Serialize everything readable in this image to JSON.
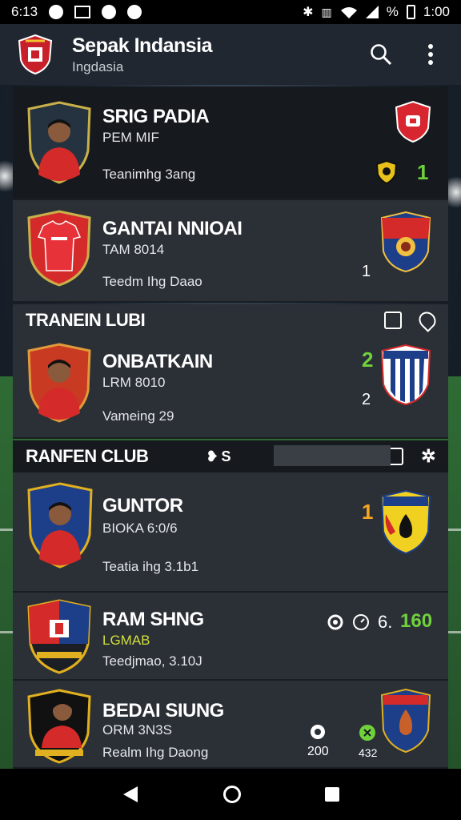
{
  "status_bar": {
    "time": "6:13",
    "right_text": "1:00",
    "battery_glyph": "%"
  },
  "app_bar": {
    "title": "Sepak Indansia",
    "subtitle": "Ingdasia",
    "search_icon": "search-icon",
    "menu_icon": "more-vert-icon"
  },
  "colors": {
    "accent_green": "#6fd23b",
    "accent_orange": "#f5a623",
    "card_bg": "#2b2f36",
    "dark_card_bg": "#16191e"
  },
  "cards": [
    {
      "name": "SRIG PADIA",
      "sub": "PEM MIF",
      "meta": "Teanimhg 3ang",
      "score_top": "",
      "score_bottom": "1"
    },
    {
      "name": "GANTAI NNIOAI",
      "sub": "TAM 8014",
      "meta": "Teedm Ihg Daao",
      "score_top": "",
      "score_bottom": "1"
    },
    {
      "name": "ONBATKAIN",
      "sub": "LRM 8010",
      "meta": "Vameing 29",
      "score_top": "2",
      "score_bottom": "2"
    },
    {
      "name": "GUNTOR",
      "sub": "BIOKA 6:0/6",
      "meta": "Teatia ihg 3.1b1",
      "score_top": "1",
      "score_bottom": ""
    },
    {
      "name": "RAM SHNG",
      "sub": "LGMAB",
      "meta": "Teedjmao, 3.10J",
      "score_top": "160",
      "score_prefix": "6.",
      "score_bottom": ""
    },
    {
      "name": "BEDAI SIUNG",
      "sub": "ORM 3N3S",
      "meta": "Realm Ihg Daong",
      "stat_left": "200",
      "stat_right": "432"
    }
  ],
  "sections": [
    {
      "label": "TRANEIN LUBI"
    },
    {
      "label": "RANFEN CLUB",
      "search_prefix": "S"
    }
  ]
}
